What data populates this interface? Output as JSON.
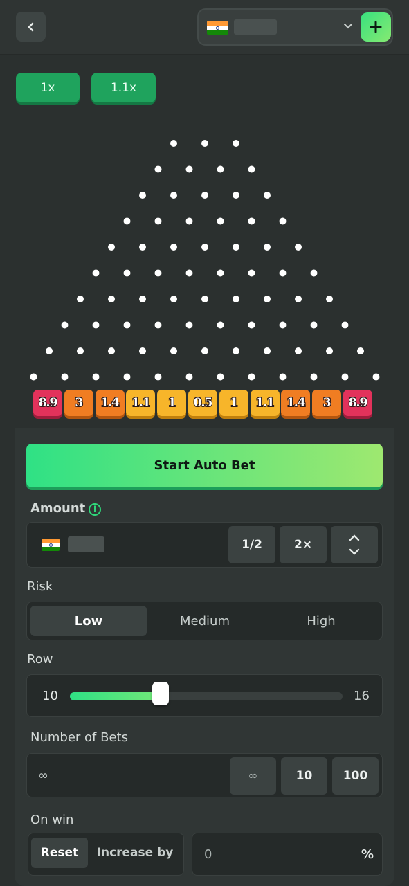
{
  "header": {
    "back_icon": "chevron-left-icon",
    "wallet": {
      "flag_icon": "india-flag-icon",
      "dropdown_icon": "chevron-down-icon",
      "add_icon": "plus-icon"
    }
  },
  "multipliers": [
    "1x",
    "1.1x"
  ],
  "board": {
    "rows": 10,
    "slots": [
      {
        "value": "8.9",
        "color": "#e2325b"
      },
      {
        "value": "3",
        "color": "#f07d22"
      },
      {
        "value": "1.4",
        "color": "#f07d22"
      },
      {
        "value": "1.1",
        "color": "#f7b52a"
      },
      {
        "value": "1",
        "color": "#f7b52a"
      },
      {
        "value": "0.5",
        "color": "#f7b52a"
      },
      {
        "value": "1",
        "color": "#f7b52a"
      },
      {
        "value": "1.1",
        "color": "#f7b52a"
      },
      {
        "value": "1.4",
        "color": "#f07d22"
      },
      {
        "value": "3",
        "color": "#f07d22"
      },
      {
        "value": "8.9",
        "color": "#e2325b"
      }
    ]
  },
  "start_button": "Start Auto Bet",
  "amount": {
    "label": "Amount",
    "info_icon": "info-icon",
    "half": "1/2",
    "double": "2×",
    "stepper_icon": "up-down-chevron-icon"
  },
  "risk": {
    "label": "Risk",
    "options": [
      "Low",
      "Medium",
      "High"
    ],
    "selected": "Low"
  },
  "row": {
    "label": "Row",
    "min": "10",
    "max": "16",
    "value": 12
  },
  "number_of_bets": {
    "label": "Number of Bets",
    "value": "∞",
    "presets": [
      "∞",
      "10",
      "100"
    ]
  },
  "on_win": {
    "label": "On win",
    "reset": "Reset",
    "increase_by": "Increase by",
    "value": "0",
    "unit": "%"
  },
  "colors": {
    "accent": "#2fe185",
    "accent_dark": "#1fa35d"
  }
}
